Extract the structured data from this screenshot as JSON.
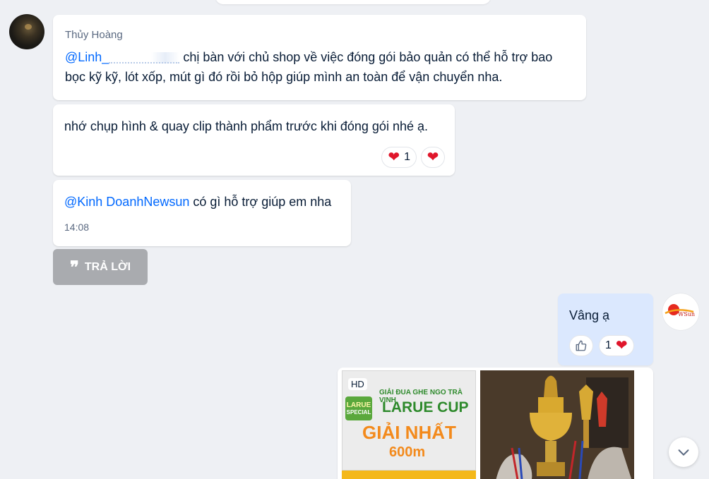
{
  "messages": [
    {
      "sender": "Thủy Hoàng",
      "mention": "@Linh_",
      "text": " chị bàn với chủ shop về việc đóng gói bảo quản có thể hỗ trợ bao bọc kỹ kỹ, lót xốp, mút gì đó rồi bỏ hộp giúp mình an toàn để vận chuyển nha."
    },
    {
      "text": "nhớ chụp hình & quay clip thành phẩm trước khi đóng gói nhé ạ.",
      "reactions": [
        {
          "emoji": "heart",
          "count": "1"
        },
        {
          "emoji": "heart",
          "count": ""
        }
      ]
    },
    {
      "mention": "@Kinh DoanhNewsun",
      "text": " có gì hỗ trợ giúp em nha",
      "time": "14:08"
    }
  ],
  "reply_button": {
    "label": "TRẢ LỜI",
    "icon": "quote-icon"
  },
  "own_message": {
    "text": "Vâng ạ",
    "reactions": {
      "like_icon": "thumbs-up-icon",
      "count": "1",
      "emoji": "heart"
    }
  },
  "image_message": {
    "hd_badge": "HD",
    "poster": {
      "brand": "LARUE",
      "brand_sub": "SPECIAL",
      "subtitle": "GIẢI ĐUA GHE NGO TRÀ VINH",
      "title": "LARUE CUP",
      "prize": "GIẢI NHẤT",
      "distance": "600m"
    }
  },
  "right_avatar_text": "WSun",
  "colors": {
    "mention": "#0068ff",
    "heart": "#e0162b",
    "own_bubble": "#dbe8fe",
    "reply_button": "#a9abaf",
    "background": "#eef0f4"
  }
}
